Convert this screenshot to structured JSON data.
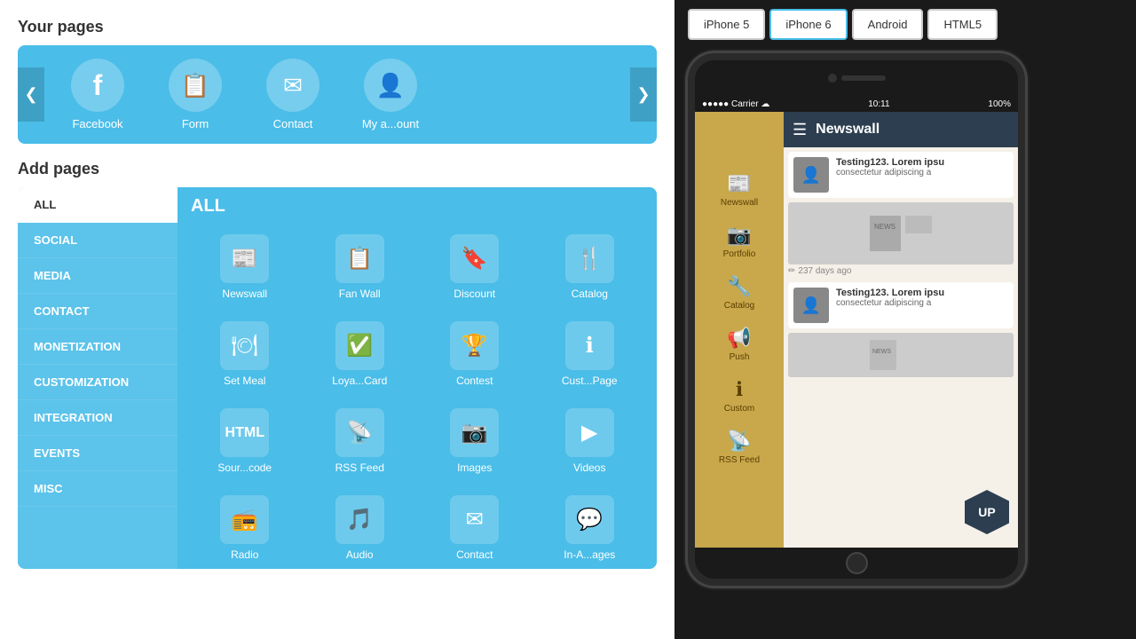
{
  "leftPanel": {
    "yourPagesTitle": "Your pages",
    "addPagesTitle": "Add pages",
    "carousel": {
      "prevArrow": "❮",
      "nextArrow": "❯",
      "items": [
        {
          "label": "Facebook",
          "icon": "f"
        },
        {
          "label": "Form",
          "icon": "📋"
        },
        {
          "label": "Contact",
          "icon": "✉"
        },
        {
          "label": "My a...ount",
          "icon": "👤"
        }
      ]
    },
    "categories": [
      {
        "label": "ALL",
        "active": true
      },
      {
        "label": "SOCIAL",
        "active": false
      },
      {
        "label": "MEDIA",
        "active": false
      },
      {
        "label": "CONTACT",
        "active": false
      },
      {
        "label": "MONETIZATION",
        "active": false
      },
      {
        "label": "CUSTOMIZATION",
        "active": false
      },
      {
        "label": "INTEGRATION",
        "active": false
      },
      {
        "label": "EVENTS",
        "active": false
      },
      {
        "label": "MISC",
        "active": false
      }
    ],
    "gridTitle": "ALL",
    "gridItems": [
      {
        "label": "Newswall",
        "icon": "📰"
      },
      {
        "label": "Fan Wall",
        "icon": "📋"
      },
      {
        "label": "Discount",
        "icon": "🔖"
      },
      {
        "label": "Catalog",
        "icon": "🍴"
      },
      {
        "label": "Set Meal",
        "icon": "🍽"
      },
      {
        "label": "Loya...Card",
        "icon": "✅"
      },
      {
        "label": "Contest",
        "icon": "🏆"
      },
      {
        "label": "Cust...Page",
        "icon": "ℹ"
      },
      {
        "label": "Sour...code",
        "icon": "📄"
      },
      {
        "label": "RSS Feed",
        "icon": "📡"
      },
      {
        "label": "Images",
        "icon": "📷"
      },
      {
        "label": "Videos",
        "icon": "▶"
      },
      {
        "label": "Radio",
        "icon": "📻"
      },
      {
        "label": "Audio",
        "icon": "🎵"
      },
      {
        "label": "Contact",
        "icon": "✉"
      },
      {
        "label": "In-A...ages",
        "icon": "💬"
      }
    ]
  },
  "rightPanel": {
    "deviceButtons": [
      {
        "label": "iPhone 5",
        "active": false
      },
      {
        "label": "iPhone 6",
        "active": true
      },
      {
        "label": "Android",
        "active": false
      },
      {
        "label": "HTML5",
        "active": false
      }
    ],
    "phone": {
      "statusBar": {
        "carrier": "●●●●● Carrier  ☁",
        "time": "10:11",
        "battery": "100%"
      },
      "sidebar": {
        "items": [
          {
            "label": "Newswall",
            "icon": "📰"
          },
          {
            "label": "Portfolio",
            "icon": "📷"
          },
          {
            "label": "Catalog",
            "icon": "🔧"
          },
          {
            "label": "Push",
            "icon": "📢"
          },
          {
            "label": "Custom",
            "icon": "ℹ"
          },
          {
            "label": "RSS Feed",
            "icon": "📡"
          }
        ]
      },
      "header": {
        "hamburger": "☰",
        "title": "Newswall"
      },
      "newsItems": [
        {
          "title": "Testing123. Lorem ipsu",
          "excerpt": "consectetur adipiscing a",
          "hasThumb": true,
          "timestamp": null
        },
        {
          "title": "",
          "excerpt": "",
          "hasThumb": false,
          "isBigImage": true,
          "timestamp": "237 days ago"
        },
        {
          "title": "Testing123. Lorem ipsu",
          "excerpt": "consectetur adipiscing a",
          "hasThumb": true,
          "timestamp": null
        }
      ]
    },
    "upBadge": "UP"
  }
}
